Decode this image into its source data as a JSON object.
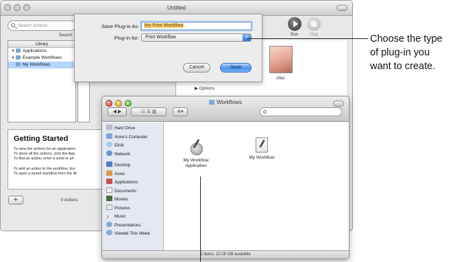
{
  "automator": {
    "title": "Untitled",
    "search_placeholder": "Search Actions",
    "search_caption": "Search",
    "library_header": "Library",
    "library_items": [
      "Applications",
      "Example Workflows",
      "My Workflows"
    ],
    "run_label": "Run",
    "stop_label": "Stop",
    "after_label": "After",
    "options_label": "▶ Options",
    "getting_started": {
      "title": "Getting Started",
      "lines": [
        "To view the actions for an application",
        "To show all the actions, click the App",
        "To find an action, enter a word or ph",
        "",
        "To add an action to the workflow, dra",
        "To open a saved workflow from the lib"
      ]
    },
    "add_label": "+",
    "actions_count": "0 Actions"
  },
  "save_sheet": {
    "save_as_label": "Save Plug-in As:",
    "save_as_value": "My Print Workflow",
    "plugin_for_label": "Plug-in for:",
    "plugin_for_value": "Print Workflow",
    "cancel_label": "Cancel",
    "save_label": "Save"
  },
  "finder": {
    "title": "Workflows",
    "sidebar": [
      "Hard Drive",
      "Anne's Computer",
      "iDisk",
      "Network",
      "Desktop",
      "Anne",
      "Applications",
      "Documents",
      "Movies",
      "Pictures",
      "Music",
      "Presentations",
      "Viewed This Week"
    ],
    "files": [
      {
        "line1": "My Workflow",
        "line2": "Application"
      },
      {
        "line1": "My Workflow",
        "line2": ""
      }
    ],
    "status": "2 items, 22.05 GB available"
  },
  "callout": {
    "line1": "Choose the type",
    "line2": "of plug-in you",
    "line3": "want to create."
  }
}
